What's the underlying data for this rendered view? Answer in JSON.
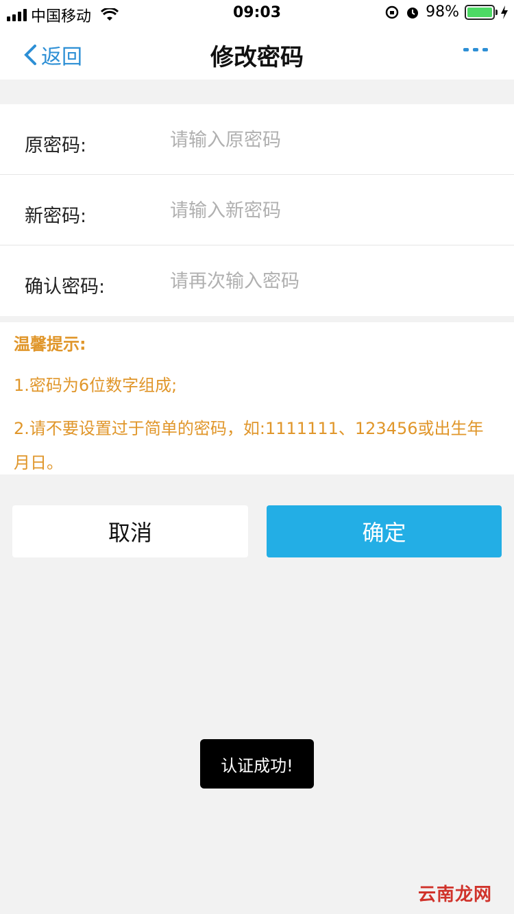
{
  "status_bar": {
    "carrier": "中国移动",
    "time": "09:03",
    "battery": "98%",
    "icons": [
      "signal-icon",
      "wifi-icon",
      "orientation-lock-icon",
      "alarm-icon",
      "battery-icon",
      "charging-icon"
    ]
  },
  "nav": {
    "back_label": "返回",
    "title": "修改密码",
    "accent_color": "#2d8fd5"
  },
  "form": {
    "old_password": {
      "label": "原密码:",
      "placeholder": "请输入原密码",
      "value": ""
    },
    "new_password": {
      "label": "新密码:",
      "placeholder": "请输入新密码",
      "value": ""
    },
    "confirm_password": {
      "label": "确认密码:",
      "placeholder": "请再次输入密码",
      "value": ""
    }
  },
  "tips": {
    "title": "温馨提示:",
    "line1": "1.密码为6位数字组成;",
    "line2": "2.请不要设置过于简单的密码，如:1111111、123456或出生年月日。",
    "color": "#e0962a"
  },
  "buttons": {
    "cancel_label": "取消",
    "ok_label": "确定",
    "ok_color": "#23aee5"
  },
  "toast": {
    "message": "认证成功!"
  },
  "watermark": {
    "text": "云南龙网"
  }
}
